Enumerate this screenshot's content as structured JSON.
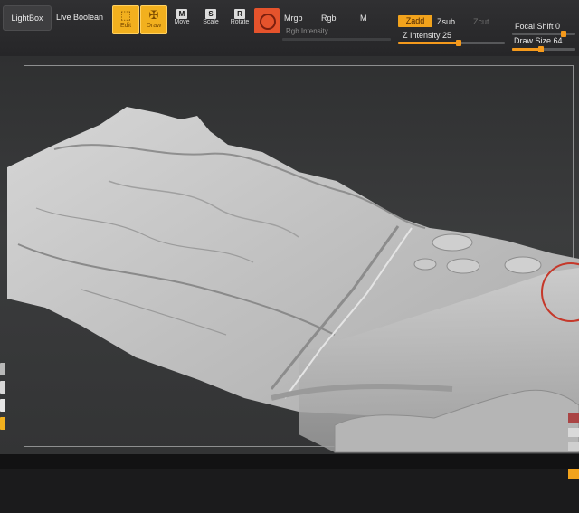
{
  "toolbar": {
    "lightbox_label": "LightBox",
    "live_boolean_label": "Live Boolean",
    "tools": [
      {
        "label": "Edit",
        "icon": "edit-icon"
      },
      {
        "label": "Draw",
        "icon": "draw-icon"
      },
      {
        "label": "Move",
        "key": "M",
        "icon": "move-icon"
      },
      {
        "label": "Scale",
        "key": "S",
        "icon": "scale-icon"
      },
      {
        "label": "Rotate",
        "key": "R",
        "icon": "rotate-icon"
      }
    ],
    "material_icon": "material-sphere-icon",
    "mrgb_label": "Mrgb",
    "rgb_label": "Rgb",
    "m_label": "M",
    "rgb_intensity_label": "Rgb Intensity",
    "zadd_label": "Zadd",
    "zsub_label": "Zsub",
    "zcut_label": "Zcut",
    "z_intensity_label": "Z Intensity",
    "z_intensity_value": "25",
    "focal_shift_label": "Focal Shift",
    "focal_shift_value": "0",
    "draw_size_label": "Draw Size",
    "draw_size_value": "64",
    "accent_color": "#f2b01e"
  },
  "viewport": {
    "content": "sculpted-terrain-mesh",
    "cursor_icon": "brush-cursor-ring-icon",
    "cursor_color": "#c5382a"
  }
}
